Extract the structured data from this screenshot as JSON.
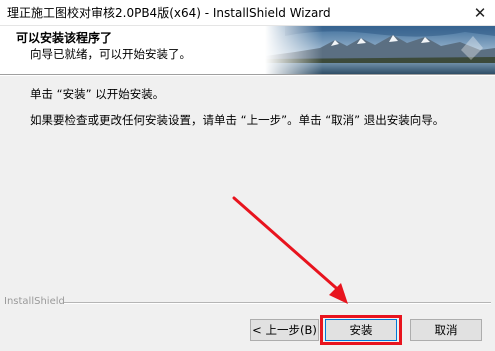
{
  "window": {
    "title": "理正施工图校对审核2.0PB4版(x64) - InstallShield Wizard",
    "close_glyph": "✕"
  },
  "banner": {
    "title": "可以安装该程序了",
    "subtitle": "向导已就绪，可以开始安装了。"
  },
  "body": {
    "line1": "单击 “安装” 以开始安装。",
    "line2": "如果要检查或更改任何安装设置，请单击 “上一步”。单击 “取消” 退出安装向导。"
  },
  "footer": {
    "brand": "InstallShield"
  },
  "buttons": {
    "back": "< 上一步(B)",
    "install": "安装",
    "cancel": "取消"
  },
  "annotation": {
    "arrow_color": "#e8141e",
    "highlight_color": "#e8141e"
  }
}
